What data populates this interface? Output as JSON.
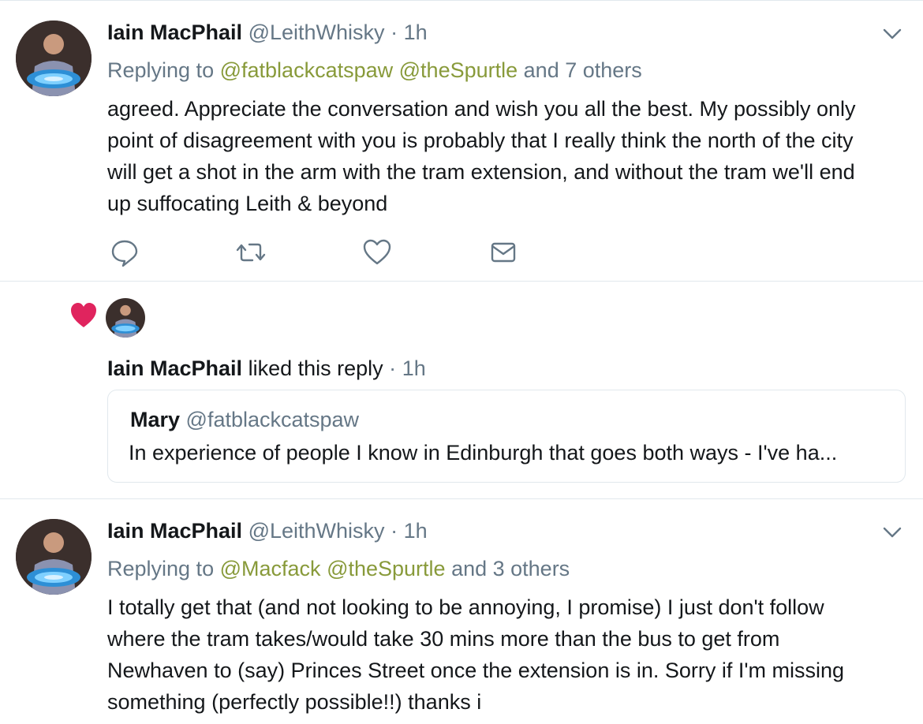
{
  "tweets": [
    {
      "name": "Iain MacPhail",
      "handle": "@LeithWhisky",
      "separator": "·",
      "time": "1h",
      "replying_prefix": "Replying to",
      "mentions": [
        "@fatblackcatspaw",
        "@theSpurtle"
      ],
      "others": "and 7 others",
      "lines": [
        "agreed. Appreciate the conversation and wish you all the best. My possibly only",
        "point of disagreement with you is probably that I really think the north of the city",
        "will get a shot in the arm with the tram extension, and without the tram we'll end",
        "up suffocating Leith & beyond"
      ]
    },
    {
      "name": "Iain MacPhail",
      "handle": "@LeithWhisky",
      "separator": "·",
      "time": "1h",
      "replying_prefix": "Replying to",
      "mentions": [
        "@Macfack",
        "@theSpurtle"
      ],
      "others": "and 3 others",
      "lines": [
        "I totally get that (and not looking to be annoying, I promise) I just don't follow",
        "where the tram takes/would take 30 mins more than the bus to get from",
        "Newhaven to (say) Princes Street once the extension is in. Sorry if I'm missing",
        "something (perfectly possible!!) thanks i"
      ]
    }
  ],
  "like_activity": {
    "name": "Iain MacPhail",
    "action": "liked this reply",
    "separator": "·",
    "time": "1h",
    "quoted": {
      "name": "Mary",
      "handle": "@fatblackcatspaw",
      "text": "In experience of people I know in Edinburgh that goes both ways - I've ha..."
    }
  },
  "colors": {
    "like_heart": "#e0245e",
    "mention": "#889a3a",
    "secondary_text": "#657786",
    "icon": "#657786"
  },
  "icons": [
    "reply-icon",
    "retweet-icon",
    "like-icon",
    "direct-message-icon",
    "chevron-down-icon",
    "heart-icon"
  ]
}
